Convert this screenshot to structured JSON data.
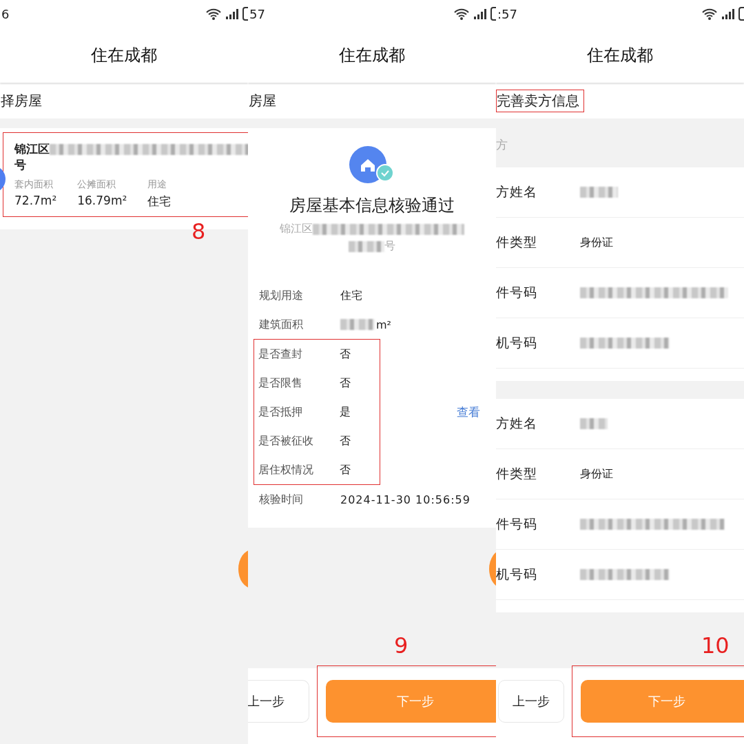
{
  "panels": [
    {
      "kind": "select_house",
      "time": "6",
      "title": "住在成都",
      "step": {
        "text": "择房屋",
        "highlighted": false
      },
      "house": {
        "address_start": "锦江区",
        "address_end": "号",
        "highlighted": true,
        "stats": [
          {
            "label": "套内面积",
            "value": "72.7m²"
          },
          {
            "label": "公摊面积",
            "value": "16.79m²"
          },
          {
            "label": "用途",
            "value": "住宅"
          }
        ]
      },
      "annotation": "8"
    },
    {
      "kind": "verify",
      "time": "57",
      "title": "住在成都",
      "step": {
        "text": "房屋",
        "highlighted": false
      },
      "result": {
        "title": "房屋基本信息核验通过",
        "address_start": "锦江区",
        "address_end": "号",
        "rows": [
          {
            "label": "规划用途",
            "value": "住宅",
            "highlighted": false
          },
          {
            "label": "建筑面积",
            "value": "m²",
            "redacted": true,
            "highlighted": false
          },
          {
            "label": "是否查封",
            "value": "否",
            "highlighted": true
          },
          {
            "label": "是否限售",
            "value": "否",
            "highlighted": true
          },
          {
            "label": "是否抵押",
            "value": "是",
            "highlighted": true,
            "link": "查看"
          },
          {
            "label": "是否被征收",
            "value": "否",
            "highlighted": true
          },
          {
            "label": "居住权情况",
            "value": "否",
            "highlighted": true
          },
          {
            "label": "核验时间",
            "value": "2024-11-30 10:56:59",
            "highlighted": false
          }
        ]
      },
      "annotation": "9",
      "buttons": [
        {
          "label": "上一步",
          "kind": "secondary",
          "highlighted": false
        },
        {
          "label": "下一步",
          "kind": "primary",
          "highlighted": true
        }
      ]
    },
    {
      "kind": "seller_info",
      "time": ":57",
      "title": "住在成都",
      "step": {
        "text": "完善卖方信息",
        "highlighted": true
      },
      "section": "方",
      "groups": [
        [
          {
            "label": "方姓名",
            "redacted": true
          },
          {
            "label": "件类型",
            "value": "身份证"
          },
          {
            "label": "件号码",
            "redacted": true
          },
          {
            "label": "机号码",
            "redacted": true
          }
        ],
        [
          {
            "label": "方姓名",
            "redacted": true
          },
          {
            "label": "件类型",
            "value": "身份证"
          },
          {
            "label": "件号码",
            "redacted": true
          },
          {
            "label": "机号码",
            "redacted": true
          }
        ]
      ],
      "annotation": "10",
      "buttons": [
        {
          "label": "上一步",
          "kind": "secondary",
          "highlighted": false
        },
        {
          "label": "下一步",
          "kind": "primary",
          "highlighted": true
        }
      ]
    }
  ]
}
